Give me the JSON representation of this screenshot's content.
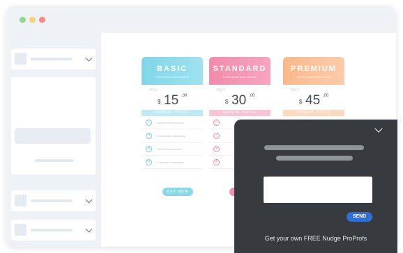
{
  "window": {
    "dots": [
      "green",
      "yellow",
      "red"
    ]
  },
  "pricing": {
    "plans": [
      {
        "name": "BASIC",
        "subtitle": "Lorem ipsum dolor sit amet",
        "only": "ONLY",
        "currency": "$",
        "amount": "15",
        "cents": ".00",
        "band": "ANNUAL PRICE",
        "features": [
          {
            "icon": "check",
            "text": "Lorem ipsum dolor sit"
          },
          {
            "icon": "cross",
            "text": "Consectetur adipiscing"
          },
          {
            "icon": "cross",
            "text": "Sed do eiusmod sed"
          },
          {
            "icon": "cross",
            "text": "Commodo consequat"
          }
        ],
        "button": "GET NOW"
      },
      {
        "name": "STANDARD",
        "subtitle": "Lorem ipsum dolor sit amet",
        "only": "ONLY",
        "currency": "$",
        "amount": "30",
        "cents": ".00",
        "band": "ANNUAL PRICE",
        "features": [
          {
            "icon": "check",
            "text": ""
          },
          {
            "icon": "check",
            "text": ""
          },
          {
            "icon": "cross",
            "text": ""
          },
          {
            "icon": "cross",
            "text": ""
          }
        ],
        "button": ""
      },
      {
        "name": "PREMIUM",
        "subtitle": "Lorem ipsum dolor sit amet",
        "only": "ONLY",
        "currency": "$",
        "amount": "45",
        "cents": ".00",
        "band": "ANNUAL PRICE",
        "features": [],
        "button": ""
      }
    ]
  },
  "popup": {
    "send_label": "SEND",
    "footer": "Get your own FREE Nudge ProProfs"
  },
  "colors": {
    "basic": "#8ad8e8",
    "standard": "#f58fb0",
    "premium": "#fbbf94",
    "popup_bg": "#373a3f",
    "send": "#2f6fd8"
  }
}
